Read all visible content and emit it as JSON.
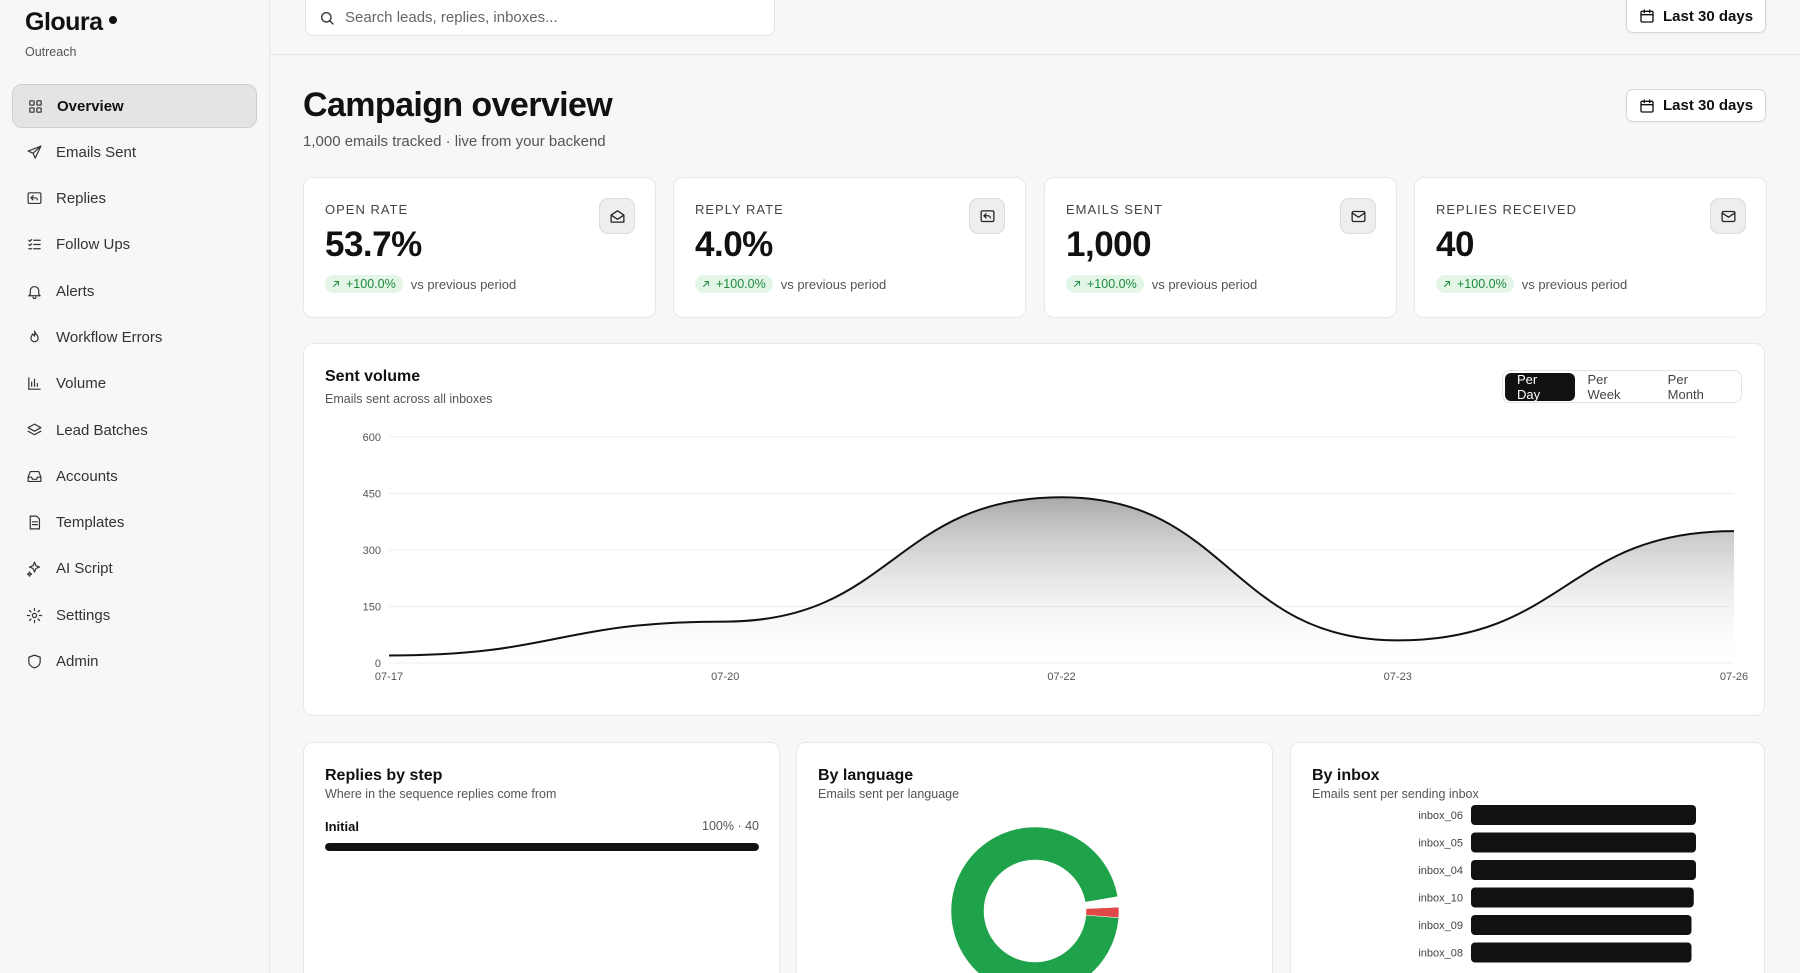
{
  "brand": {
    "name": "Gloura",
    "subtitle": "Outreach"
  },
  "nav": [
    {
      "label": "Overview",
      "icon": "grid-icon",
      "active": true
    },
    {
      "label": "Emails Sent",
      "icon": "send-icon"
    },
    {
      "label": "Replies",
      "icon": "reply-icon"
    },
    {
      "label": "Follow Ups",
      "icon": "list-check-icon"
    },
    {
      "label": "Alerts",
      "icon": "bell-icon"
    },
    {
      "label": "Workflow Errors",
      "icon": "flame-icon"
    },
    {
      "label": "Volume",
      "icon": "bar-chart-icon"
    },
    {
      "label": "Lead Batches",
      "icon": "layers-icon"
    },
    {
      "label": "Accounts",
      "icon": "inbox-icon"
    },
    {
      "label": "Templates",
      "icon": "file-icon"
    },
    {
      "label": "AI Script",
      "icon": "sparkles-icon"
    },
    {
      "label": "Settings",
      "icon": "gear-icon"
    },
    {
      "label": "Admin",
      "icon": "shield-icon"
    }
  ],
  "search": {
    "placeholder": "Search leads, replies, inboxes..."
  },
  "date_range": {
    "label": "Last 30 days"
  },
  "page": {
    "title": "Campaign overview",
    "subtitle": "1,000 emails tracked · live from your backend"
  },
  "kpis": [
    {
      "label": "OPEN RATE",
      "value": "53.7%",
      "delta": "+100.0%",
      "delta_text": "vs previous period",
      "icon": "mail-open-icon"
    },
    {
      "label": "REPLY RATE",
      "value": "4.0%",
      "delta": "+100.0%",
      "delta_text": "vs previous period",
      "icon": "reply-icon"
    },
    {
      "label": "EMAILS SENT",
      "value": "1,000",
      "delta": "+100.0%",
      "delta_text": "vs previous period",
      "icon": "mail-icon"
    },
    {
      "label": "REPLIES RECEIVED",
      "value": "40",
      "delta": "+100.0%",
      "delta_text": "vs previous period",
      "icon": "mail-icon"
    }
  ],
  "volume_card": {
    "title": "Sent volume",
    "subtitle": "Emails sent across all inboxes",
    "tabs": [
      {
        "label": "Per Day",
        "active": true
      },
      {
        "label": "Per Week",
        "active": false
      },
      {
        "label": "Per Month",
        "active": false
      }
    ]
  },
  "replies_card": {
    "title": "Replies by step",
    "subtitle": "Where in the sequence replies come from",
    "steps": [
      {
        "name": "Initial",
        "value_text": "100% · 40",
        "fraction": 1.0
      }
    ]
  },
  "language_card": {
    "title": "By language",
    "subtitle": "Emails sent per language"
  },
  "inbox_card": {
    "title": "By inbox",
    "subtitle": "Emails sent per sending inbox"
  },
  "colors": {
    "accent": "#111111",
    "positive": "#1e8a3c",
    "donut_main": "#1fa34a",
    "donut_minor": "#e04848"
  },
  "chart_data": [
    {
      "type": "area",
      "x": [
        "07-17",
        "07-20",
        "07-22",
        "07-23",
        "07-26"
      ],
      "y": [
        20,
        110,
        440,
        60,
        350
      ],
      "ylim": [
        0,
        600
      ],
      "yticks": [
        0,
        150,
        300,
        450,
        600
      ],
      "grid": true
    },
    {
      "type": "pie",
      "values": [
        0.96,
        0.02,
        0.02
      ]
    },
    {
      "type": "bar",
      "orientation": "horizontal",
      "categories": [
        "inbox_06",
        "inbox_05",
        "inbox_04",
        "inbox_10",
        "inbox_09",
        "inbox_08"
      ],
      "values": [
        1.0,
        1.0,
        1.0,
        0.99,
        0.98,
        0.98
      ]
    }
  ]
}
